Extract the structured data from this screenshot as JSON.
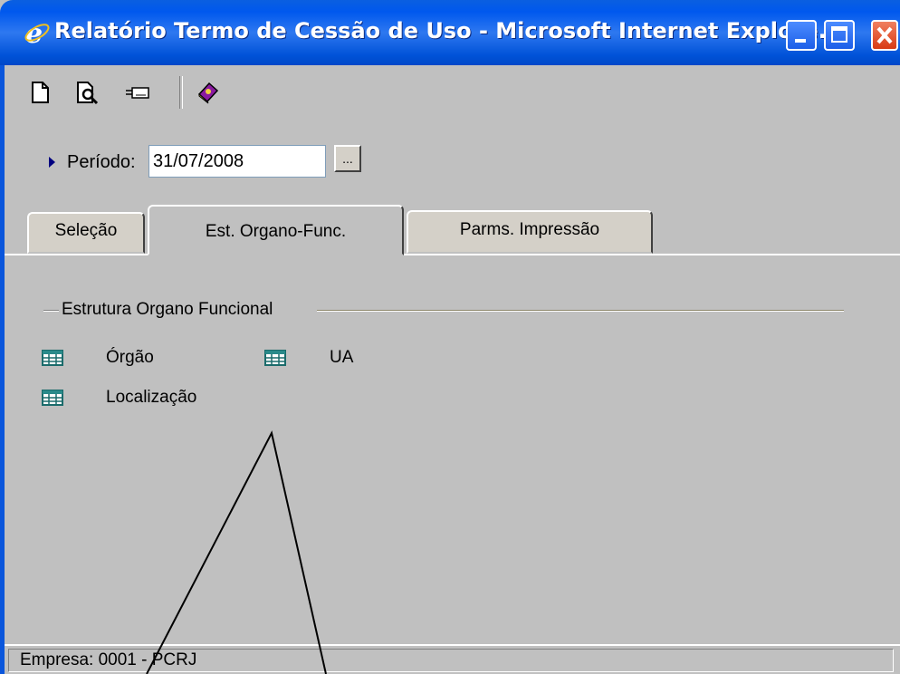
{
  "window": {
    "title": "Relatório Termo de Cessão de Uso - Microsoft Internet Explore...",
    "title_color": "#0058ee"
  },
  "toolbar": {
    "icons": [
      "new-document-icon",
      "print-preview-icon",
      "export-icon",
      "help-book-icon"
    ]
  },
  "filter": {
    "period_label": "Período:",
    "period_value": "31/07/2008",
    "picker_label": "..."
  },
  "tabs": [
    {
      "label": "Seleção",
      "active": false
    },
    {
      "label": "Est. Organo-Func.",
      "active": true
    },
    {
      "label": "Parms. Impressão",
      "active": false
    }
  ],
  "group": {
    "title": "Estrutura Organo Funcional",
    "items": [
      {
        "label": "Órgão",
        "icon": "grid-icon"
      },
      {
        "label": "UA",
        "icon": "grid-icon"
      },
      {
        "label": "Localização",
        "icon": "grid-icon"
      }
    ]
  },
  "status": {
    "text": "Empresa: 0001 - PCRJ"
  }
}
